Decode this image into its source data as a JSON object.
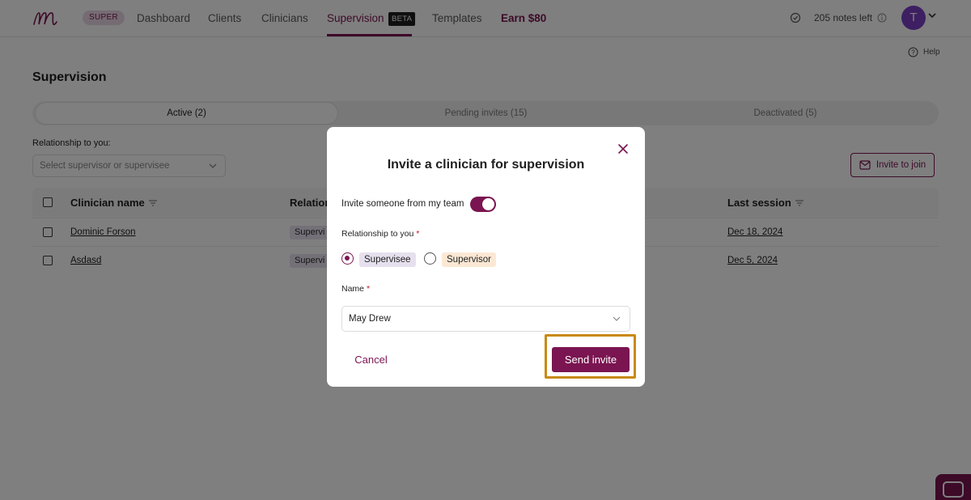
{
  "nav": {
    "logo_icon": "cursive-m-logo-icon",
    "badge": "SUPER",
    "items": [
      {
        "label": "Dashboard"
      },
      {
        "label": "Clients"
      },
      {
        "label": "Clinicians"
      },
      {
        "label": "Supervision"
      },
      {
        "label": "Templates"
      },
      {
        "label": "Earn $80"
      }
    ],
    "beta": "BETA",
    "notes_left": "205 notes left",
    "avatar_initial": "T"
  },
  "help": "Help",
  "page": {
    "title": "Supervision",
    "tabs": [
      {
        "label": "Active (2)"
      },
      {
        "label": "Pending invites (15)"
      },
      {
        "label": "Deactivated (5)"
      }
    ],
    "relationship_label": "Relationship to you:",
    "relationship_placeholder": "Select supervisor or supervisee",
    "invite_button": "Invite to join"
  },
  "table": {
    "columns": [
      "Clinician name",
      "Relation",
      "Last session"
    ],
    "rows": [
      {
        "name": "Dominic Forson",
        "relationship": "Supervi",
        "last_session": "Dec 18, 2024"
      },
      {
        "name": "Asdasd",
        "relationship": "Supervi",
        "last_session": "Dec 5, 2024"
      }
    ]
  },
  "modal": {
    "title": "Invite a clinician for supervision",
    "team_toggle_label": "Invite someone from my team",
    "team_toggle_on": true,
    "relationship_label": "Relationship to you",
    "required_mark": "*",
    "options": [
      {
        "label": "Supervisee",
        "selected": true
      },
      {
        "label": "Supervisor",
        "selected": false
      }
    ],
    "name_label": "Name",
    "name_value": "May Drew",
    "cancel": "Cancel",
    "send": "Send invite"
  },
  "colors": {
    "brand": "#7a1551",
    "highlight": "#c98a12",
    "avatar": "#7a3fc4"
  }
}
